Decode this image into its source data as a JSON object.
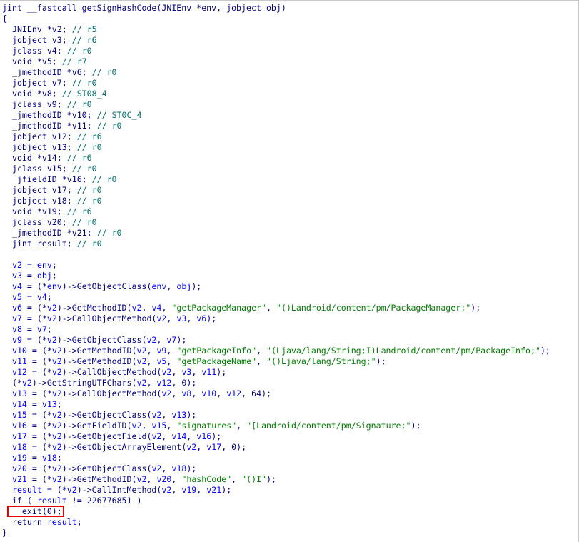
{
  "colors": {
    "background": "#ffffff",
    "default": "#000080",
    "variable": "#0000ff",
    "string": "#008000",
    "comment": "#006a6a",
    "highlight_border": "#e00000"
  },
  "code_lines": [
    [
      [
        "d",
        "jint __fastcall getSignHashCode(JNIEnv *env, jobject obj)"
      ]
    ],
    [
      [
        "d",
        "{"
      ]
    ],
    [
      [
        "d",
        "  JNIEnv *v2; "
      ],
      [
        "c",
        "// r5"
      ]
    ],
    [
      [
        "d",
        "  jobject v3; "
      ],
      [
        "c",
        "// r6"
      ]
    ],
    [
      [
        "d",
        "  jclass v4; "
      ],
      [
        "c",
        "// r0"
      ]
    ],
    [
      [
        "d",
        "  void *v5; "
      ],
      [
        "c",
        "// r7"
      ]
    ],
    [
      [
        "d",
        "  _jmethodID *v6; "
      ],
      [
        "c",
        "// r0"
      ]
    ],
    [
      [
        "d",
        "  jobject v7; "
      ],
      [
        "c",
        "// r0"
      ]
    ],
    [
      [
        "d",
        "  void *v8; "
      ],
      [
        "c",
        "// ST08_4"
      ]
    ],
    [
      [
        "d",
        "  jclass v9; "
      ],
      [
        "c",
        "// r0"
      ]
    ],
    [
      [
        "d",
        "  _jmethodID *v10; "
      ],
      [
        "c",
        "// ST0C_4"
      ]
    ],
    [
      [
        "d",
        "  _jmethodID *v11; "
      ],
      [
        "c",
        "// r0"
      ]
    ],
    [
      [
        "d",
        "  jobject v12; "
      ],
      [
        "c",
        "// r6"
      ]
    ],
    [
      [
        "d",
        "  jobject v13; "
      ],
      [
        "c",
        "// r0"
      ]
    ],
    [
      [
        "d",
        "  void *v14; "
      ],
      [
        "c",
        "// r6"
      ]
    ],
    [
      [
        "d",
        "  jclass v15; "
      ],
      [
        "c",
        "// r0"
      ]
    ],
    [
      [
        "d",
        "  _jfieldID *v16; "
      ],
      [
        "c",
        "// r0"
      ]
    ],
    [
      [
        "d",
        "  jobject v17; "
      ],
      [
        "c",
        "// r0"
      ]
    ],
    [
      [
        "d",
        "  jobject v18; "
      ],
      [
        "c",
        "// r0"
      ]
    ],
    [
      [
        "d",
        "  void *v19; "
      ],
      [
        "c",
        "// r6"
      ]
    ],
    [
      [
        "d",
        "  jclass v20; "
      ],
      [
        "c",
        "// r0"
      ]
    ],
    [
      [
        "d",
        "  _jmethodID *v21; "
      ],
      [
        "c",
        "// r0"
      ]
    ],
    [
      [
        "d",
        "  jint result; "
      ],
      [
        "c",
        "// r0"
      ]
    ],
    [],
    [
      [
        "d",
        "  "
      ],
      [
        "v",
        "v2"
      ],
      [
        "d",
        " = "
      ],
      [
        "v",
        "env"
      ],
      [
        "d",
        ";"
      ]
    ],
    [
      [
        "d",
        "  "
      ],
      [
        "v",
        "v3"
      ],
      [
        "d",
        " = "
      ],
      [
        "v",
        "obj"
      ],
      [
        "d",
        ";"
      ]
    ],
    [
      [
        "d",
        "  "
      ],
      [
        "v",
        "v4"
      ],
      [
        "d",
        " = (*"
      ],
      [
        "v",
        "env"
      ],
      [
        "d",
        ")->GetObjectClass("
      ],
      [
        "v",
        "env"
      ],
      [
        "d",
        ", "
      ],
      [
        "v",
        "obj"
      ],
      [
        "d",
        ");"
      ]
    ],
    [
      [
        "d",
        "  "
      ],
      [
        "v",
        "v5"
      ],
      [
        "d",
        " = "
      ],
      [
        "v",
        "v4"
      ],
      [
        "d",
        ";"
      ]
    ],
    [
      [
        "d",
        "  "
      ],
      [
        "v",
        "v6"
      ],
      [
        "d",
        " = (*"
      ],
      [
        "v",
        "v2"
      ],
      [
        "d",
        ")->GetMethodID("
      ],
      [
        "v",
        "v2"
      ],
      [
        "d",
        ", "
      ],
      [
        "v",
        "v4"
      ],
      [
        "d",
        ", "
      ],
      [
        "s",
        "\"getPackageManager\""
      ],
      [
        "d",
        ", "
      ],
      [
        "s",
        "\"()Landroid/content/pm/PackageManager;\""
      ],
      [
        "d",
        ");"
      ]
    ],
    [
      [
        "d",
        "  "
      ],
      [
        "v",
        "v7"
      ],
      [
        "d",
        " = (*"
      ],
      [
        "v",
        "v2"
      ],
      [
        "d",
        ")->CallObjectMethod("
      ],
      [
        "v",
        "v2"
      ],
      [
        "d",
        ", "
      ],
      [
        "v",
        "v3"
      ],
      [
        "d",
        ", "
      ],
      [
        "v",
        "v6"
      ],
      [
        "d",
        ");"
      ]
    ],
    [
      [
        "d",
        "  "
      ],
      [
        "v",
        "v8"
      ],
      [
        "d",
        " = "
      ],
      [
        "v",
        "v7"
      ],
      [
        "d",
        ";"
      ]
    ],
    [
      [
        "d",
        "  "
      ],
      [
        "v",
        "v9"
      ],
      [
        "d",
        " = (*"
      ],
      [
        "v",
        "v2"
      ],
      [
        "d",
        ")->GetObjectClass("
      ],
      [
        "v",
        "v2"
      ],
      [
        "d",
        ", "
      ],
      [
        "v",
        "v7"
      ],
      [
        "d",
        ");"
      ]
    ],
    [
      [
        "d",
        "  "
      ],
      [
        "v",
        "v10"
      ],
      [
        "d",
        " = (*"
      ],
      [
        "v",
        "v2"
      ],
      [
        "d",
        ")->GetMethodID("
      ],
      [
        "v",
        "v2"
      ],
      [
        "d",
        ", "
      ],
      [
        "v",
        "v9"
      ],
      [
        "d",
        ", "
      ],
      [
        "s",
        "\"getPackageInfo\""
      ],
      [
        "d",
        ", "
      ],
      [
        "s",
        "\"(Ljava/lang/String;I)Landroid/content/pm/PackageInfo;\""
      ],
      [
        "d",
        ");"
      ]
    ],
    [
      [
        "d",
        "  "
      ],
      [
        "v",
        "v11"
      ],
      [
        "d",
        " = (*"
      ],
      [
        "v",
        "v2"
      ],
      [
        "d",
        ")->GetMethodID("
      ],
      [
        "v",
        "v2"
      ],
      [
        "d",
        ", "
      ],
      [
        "v",
        "v5"
      ],
      [
        "d",
        ", "
      ],
      [
        "s",
        "\"getPackageName\""
      ],
      [
        "d",
        ", "
      ],
      [
        "s",
        "\"()Ljava/lang/String;\""
      ],
      [
        "d",
        ");"
      ]
    ],
    [
      [
        "d",
        "  "
      ],
      [
        "v",
        "v12"
      ],
      [
        "d",
        " = (*"
      ],
      [
        "v",
        "v2"
      ],
      [
        "d",
        ")->CallObjectMethod("
      ],
      [
        "v",
        "v2"
      ],
      [
        "d",
        ", "
      ],
      [
        "v",
        "v3"
      ],
      [
        "d",
        ", "
      ],
      [
        "v",
        "v11"
      ],
      [
        "d",
        ");"
      ]
    ],
    [
      [
        "d",
        "  (*"
      ],
      [
        "v",
        "v2"
      ],
      [
        "d",
        ")->GetStringUTFChars("
      ],
      [
        "v",
        "v2"
      ],
      [
        "d",
        ", "
      ],
      [
        "v",
        "v12"
      ],
      [
        "d",
        ", 0);"
      ]
    ],
    [
      [
        "d",
        "  "
      ],
      [
        "v",
        "v13"
      ],
      [
        "d",
        " = (*"
      ],
      [
        "v",
        "v2"
      ],
      [
        "d",
        ")->CallObjectMethod("
      ],
      [
        "v",
        "v2"
      ],
      [
        "d",
        ", "
      ],
      [
        "v",
        "v8"
      ],
      [
        "d",
        ", "
      ],
      [
        "v",
        "v10"
      ],
      [
        "d",
        ", "
      ],
      [
        "v",
        "v12"
      ],
      [
        "d",
        ", 64);"
      ]
    ],
    [
      [
        "d",
        "  "
      ],
      [
        "v",
        "v14"
      ],
      [
        "d",
        " = "
      ],
      [
        "v",
        "v13"
      ],
      [
        "d",
        ";"
      ]
    ],
    [
      [
        "d",
        "  "
      ],
      [
        "v",
        "v15"
      ],
      [
        "d",
        " = (*"
      ],
      [
        "v",
        "v2"
      ],
      [
        "d",
        ")->GetObjectClass("
      ],
      [
        "v",
        "v2"
      ],
      [
        "d",
        ", "
      ],
      [
        "v",
        "v13"
      ],
      [
        "d",
        ");"
      ]
    ],
    [
      [
        "d",
        "  "
      ],
      [
        "v",
        "v16"
      ],
      [
        "d",
        " = (*"
      ],
      [
        "v",
        "v2"
      ],
      [
        "d",
        ")->GetFieldID("
      ],
      [
        "v",
        "v2"
      ],
      [
        "d",
        ", "
      ],
      [
        "v",
        "v15"
      ],
      [
        "d",
        ", "
      ],
      [
        "s",
        "\"signatures\""
      ],
      [
        "d",
        ", "
      ],
      [
        "s",
        "\"[Landroid/content/pm/Signature;\""
      ],
      [
        "d",
        ");"
      ]
    ],
    [
      [
        "d",
        "  "
      ],
      [
        "v",
        "v17"
      ],
      [
        "d",
        " = (*"
      ],
      [
        "v",
        "v2"
      ],
      [
        "d",
        ")->GetObjectField("
      ],
      [
        "v",
        "v2"
      ],
      [
        "d",
        ", "
      ],
      [
        "v",
        "v14"
      ],
      [
        "d",
        ", "
      ],
      [
        "v",
        "v16"
      ],
      [
        "d",
        ");"
      ]
    ],
    [
      [
        "d",
        "  "
      ],
      [
        "v",
        "v18"
      ],
      [
        "d",
        " = (*"
      ],
      [
        "v",
        "v2"
      ],
      [
        "d",
        ")->GetObjectArrayElement("
      ],
      [
        "v",
        "v2"
      ],
      [
        "d",
        ", "
      ],
      [
        "v",
        "v17"
      ],
      [
        "d",
        ", 0);"
      ]
    ],
    [
      [
        "d",
        "  "
      ],
      [
        "v",
        "v19"
      ],
      [
        "d",
        " = "
      ],
      [
        "v",
        "v18"
      ],
      [
        "d",
        ";"
      ]
    ],
    [
      [
        "d",
        "  "
      ],
      [
        "v",
        "v20"
      ],
      [
        "d",
        " = (*"
      ],
      [
        "v",
        "v2"
      ],
      [
        "d",
        ")->GetObjectClass("
      ],
      [
        "v",
        "v2"
      ],
      [
        "d",
        ", "
      ],
      [
        "v",
        "v18"
      ],
      [
        "d",
        ");"
      ]
    ],
    [
      [
        "d",
        "  "
      ],
      [
        "v",
        "v21"
      ],
      [
        "d",
        " = (*"
      ],
      [
        "v",
        "v2"
      ],
      [
        "d",
        ")->GetMethodID("
      ],
      [
        "v",
        "v2"
      ],
      [
        "d",
        ", "
      ],
      [
        "v",
        "v20"
      ],
      [
        "d",
        ", "
      ],
      [
        "s",
        "\"hashCode\""
      ],
      [
        "d",
        ", "
      ],
      [
        "s",
        "\"()I\""
      ],
      [
        "d",
        ");"
      ]
    ],
    [
      [
        "d",
        "  "
      ],
      [
        "v",
        "result"
      ],
      [
        "d",
        " = (*"
      ],
      [
        "v",
        "v2"
      ],
      [
        "d",
        ")->CallIntMethod("
      ],
      [
        "v",
        "v2"
      ],
      [
        "d",
        ", "
      ],
      [
        "v",
        "v19"
      ],
      [
        "d",
        ", "
      ],
      [
        "v",
        "v21"
      ],
      [
        "d",
        ");"
      ]
    ],
    [
      [
        "d",
        "  if ( "
      ],
      [
        "v",
        "result"
      ],
      [
        "d",
        " != 226776851 )"
      ]
    ],
    [
      [
        "d",
        "    exit(0);"
      ]
    ],
    [
      [
        "d",
        "  return "
      ],
      [
        "v",
        "result"
      ],
      [
        "d",
        ";"
      ]
    ],
    [
      [
        "d",
        "}"
      ]
    ]
  ]
}
